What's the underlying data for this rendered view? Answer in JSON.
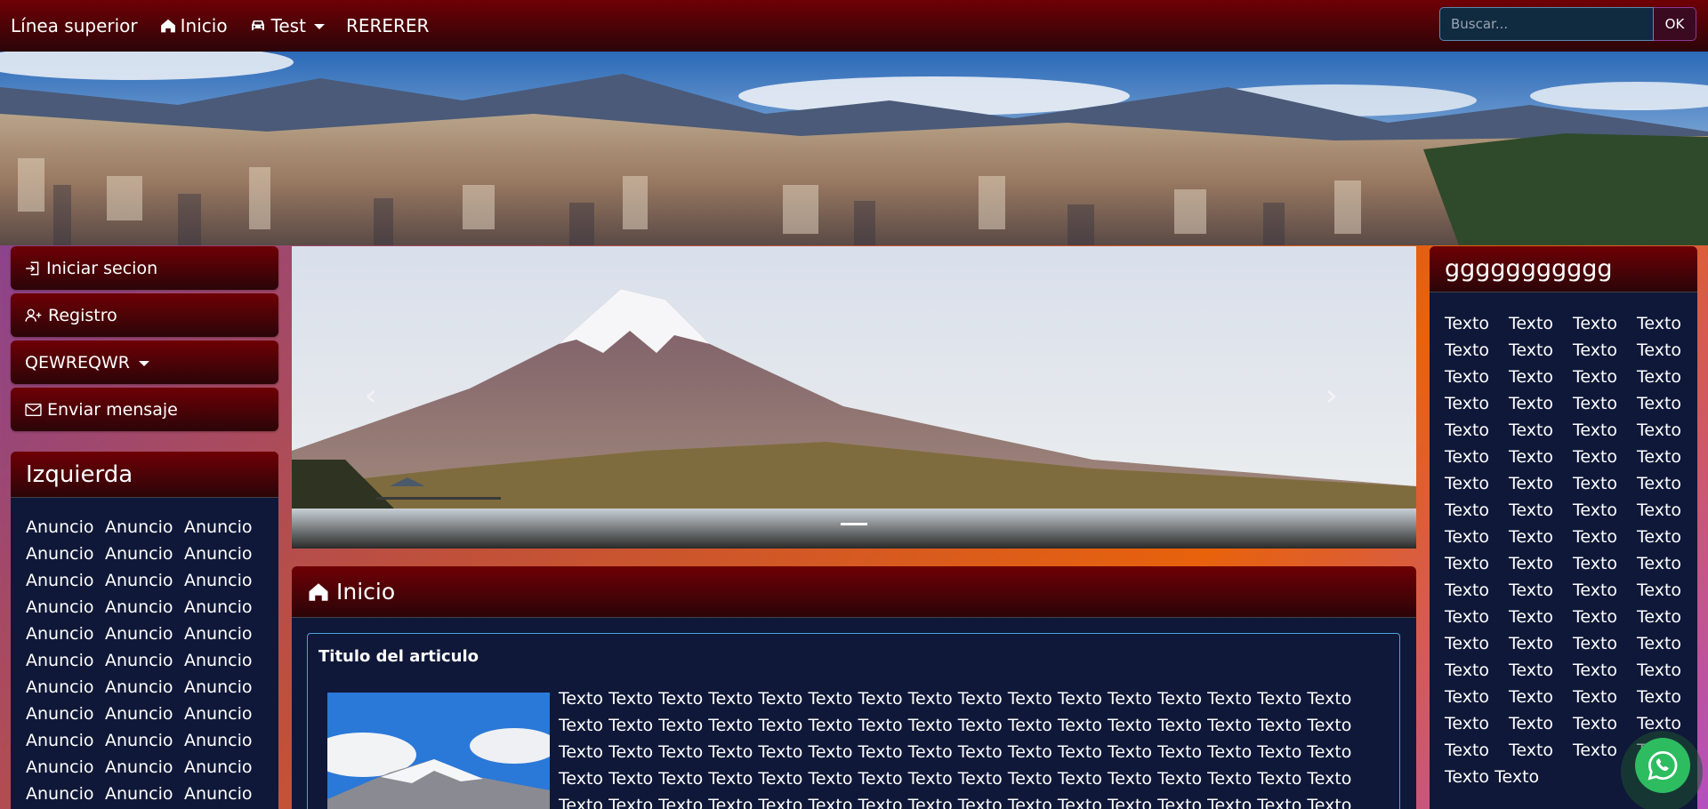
{
  "navbar": {
    "brand": "Línea superior",
    "links": [
      {
        "label": "Inicio",
        "icon": "home-icon"
      },
      {
        "label": "Test",
        "icon": "car-icon",
        "dropdown": true
      },
      {
        "label": "RERERER"
      }
    ],
    "search": {
      "placeholder": "Buscar...",
      "value": "",
      "button_label": "OK"
    }
  },
  "left_sidebar": {
    "buttons": [
      {
        "label": "Iniciar secion",
        "icon": "login-icon"
      },
      {
        "label": "Registro",
        "icon": "person-add-icon"
      },
      {
        "label": "QEWREQWR",
        "dropdown": true
      },
      {
        "label": "Enviar mensaje",
        "icon": "envelope-icon"
      }
    ],
    "card": {
      "title": "Izquierda",
      "items": [
        "Anuncio",
        "Anuncio",
        "Anuncio",
        "Anuncio",
        "Anuncio",
        "Anuncio",
        "Anuncio",
        "Anuncio",
        "Anuncio",
        "Anuncio",
        "Anuncio",
        "Anuncio",
        "Anuncio",
        "Anuncio",
        "Anuncio",
        "Anuncio",
        "Anuncio",
        "Anuncio",
        "Anuncio",
        "Anuncio",
        "Anuncio",
        "Anuncio",
        "Anuncio",
        "Anuncio",
        "Anuncio",
        "Anuncio",
        "Anuncio",
        "Anuncio",
        "Anuncio",
        "Anuncio",
        "Anuncio",
        "Anuncio",
        "Anuncio"
      ]
    }
  },
  "main": {
    "card_title": "Inicio",
    "article": {
      "title": "Titulo del articulo",
      "lines": [
        "Texto Texto Texto Texto Texto Texto Texto Texto Texto Texto Texto Texto Texto Texto Texto Texto",
        "Texto Texto Texto Texto Texto Texto Texto Texto Texto Texto Texto Texto Texto Texto Texto Texto",
        "Texto Texto Texto Texto Texto Texto Texto Texto Texto Texto Texto Texto Texto Texto Texto Texto",
        "Texto Texto Texto Texto Texto Texto Texto Texto Texto Texto Texto Texto Texto Texto Texto Texto",
        "Texto Texto Texto Texto Texto Texto Texto Texto Texto Texto Texto Texto Texto Texto Texto Texto"
      ]
    }
  },
  "right_sidebar": {
    "title": "ggggggggggg",
    "items": [
      "Texto",
      "Texto",
      "Texto",
      "Texto",
      "Texto",
      "Texto",
      "Texto",
      "Texto",
      "Texto",
      "Texto",
      "Texto",
      "Texto",
      "Texto",
      "Texto",
      "Texto",
      "Texto",
      "Texto",
      "Texto",
      "Texto",
      "Texto",
      "Texto",
      "Texto",
      "Texto",
      "Texto",
      "Texto",
      "Texto",
      "Texto",
      "Texto",
      "Texto",
      "Texto",
      "Texto",
      "Texto",
      "Texto",
      "Texto",
      "Texto",
      "Texto",
      "Texto",
      "Texto",
      "Texto",
      "Texto",
      "Texto",
      "Texto",
      "Texto",
      "Texto",
      "Texto",
      "Texto",
      "Texto",
      "Texto",
      "Texto",
      "Texto",
      "Texto",
      "Texto",
      "Texto",
      "Texto",
      "Texto",
      "Texto",
      "Texto",
      "Texto",
      "Texto",
      "Texto",
      "Texto",
      "Texto",
      "Texto",
      "Texto",
      "Texto",
      "Texto",
      "Texto",
      "Texto"
    ],
    "tail": "Texto Texto"
  },
  "colors": {
    "navbar_top": "#6e0005",
    "navbar_bottom": "#2b0508",
    "card_body": "#0f1838",
    "article_border": "#4aa3d8",
    "whatsapp": "#2dbd60"
  }
}
